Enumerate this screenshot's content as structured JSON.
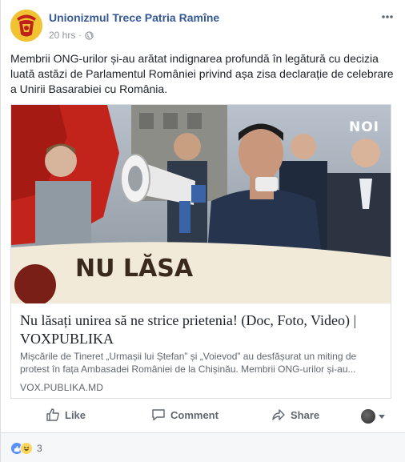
{
  "header": {
    "page_name": "Unionizmul Trece Patria Ramîne",
    "timestamp": "20 hrs",
    "separator": "·",
    "privacy_icon": "globe-icon",
    "more_icon": "more-horizontal-icon"
  },
  "post": {
    "text": "Membrii ONG-urilor și-au arătat indignarea profundă în legătură cu decizia luată astăzi de Parlamentul României privind așa zisa declarație de celebrare a Unirii Basarabiei cu România."
  },
  "link_card": {
    "image_logo": "NOI",
    "image_banner_text": "NU LĂSA",
    "title": "Nu lăsați unirea să ne strice prietenia! (Doc, Foto, Video) | VOXPUBLIKA",
    "description": "Mișcările de Tineret „Urmașii lui Ștefan” și „Voievod” au desfășurat un miting de protest în fața Ambasadei României de la Chișinău. Membrii ONG-urilor și-au...",
    "domain": "VOX.PUBLIKA.MD"
  },
  "actions": {
    "like": "Like",
    "comment": "Comment",
    "share": "Share"
  },
  "reactions": {
    "types": [
      "like",
      "haha"
    ],
    "count": "3"
  },
  "colors": {
    "link_blue": "#365899",
    "text": "#1d2129",
    "secondary": "#606770",
    "like_blue": "#5890ff",
    "haha_yellow": "#fcd65c"
  }
}
